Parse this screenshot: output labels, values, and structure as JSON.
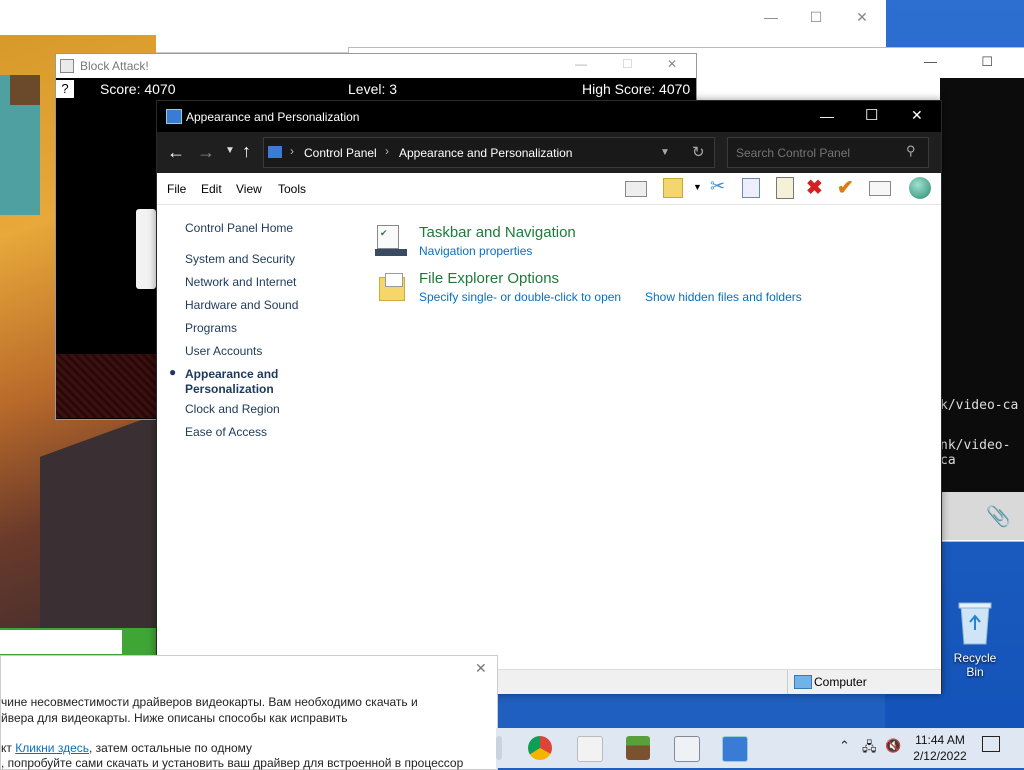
{
  "colors": {
    "accent_green": "#1f7a3a",
    "link_blue": "#0b6fbd",
    "titlebar": "#000000"
  },
  "block_attack": {
    "title": "Block Attack!",
    "help": "?",
    "score": "Score: 4070",
    "level": "Level: 3",
    "high_score": "High Score: 4070"
  },
  "control_panel": {
    "title": "Appearance and Personalization",
    "breadcrumb": [
      "Control Panel",
      "Appearance and Personalization"
    ],
    "search_placeholder": "Search Control Panel",
    "menu": [
      "File",
      "Edit",
      "View",
      "Tools"
    ],
    "sidebar": {
      "home": "Control Panel Home",
      "items": [
        "System and Security",
        "Network and Internet",
        "Hardware and Sound",
        "Programs",
        "User Accounts",
        "Appearance and Personalization",
        "Clock and Region",
        "Ease of Access"
      ],
      "active_index": 5
    },
    "categories": [
      {
        "title": "Taskbar and Navigation",
        "links": [
          "Navigation properties"
        ]
      },
      {
        "title": "File Explorer Options",
        "links": [
          "Specify single- or double-click to open",
          "Show hidden files and folders"
        ]
      }
    ],
    "status": "Computer"
  },
  "terminal": {
    "lines": [
      "k/video-ca",
      "nk/video-ca"
    ]
  },
  "russian_dialog": {
    "line1": "чине несовместимости драйверов видеокарты. Вам необходимо скачать и",
    "line2": "йвера для видеокарты. Ниже описаны способы как исправить",
    "line3_prefix": "кт ",
    "line3_link": "Кликни здесь",
    "line3_suffix": ", затем остальные по одному",
    "line4": ", попробуйте сами скачать и установить ваш драйвер для встроенной в процессор"
  },
  "desktop": {
    "recycle_bin": "Recycle Bin"
  },
  "taskbar": {
    "time": "11:44 AM",
    "date": "2/12/2022"
  }
}
